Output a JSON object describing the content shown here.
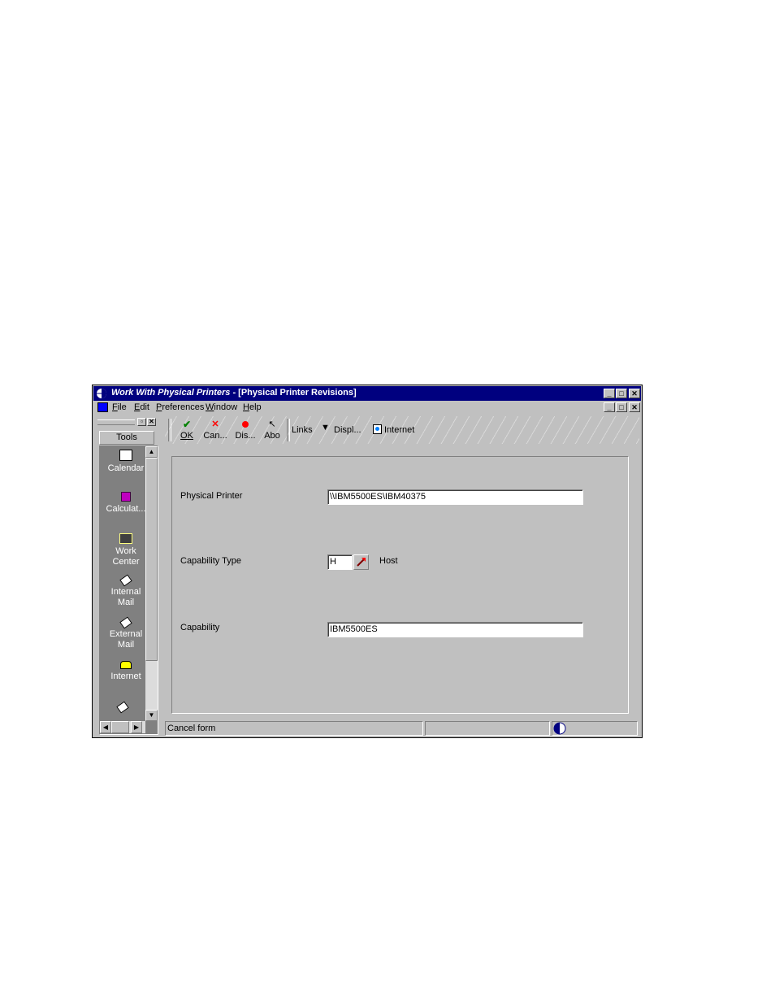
{
  "window": {
    "title_italic": "Work With Physical Printers",
    "title_rest": " - [Physical Printer Revisions]",
    "buttons": {
      "minimize": "_",
      "maximize": "□",
      "close": "✕"
    }
  },
  "menu": {
    "items": [
      {
        "underline": "F",
        "rest": "ile"
      },
      {
        "underline": "E",
        "rest": "dit"
      },
      {
        "underline": "P",
        "rest": "references"
      },
      {
        "underline": "W",
        "rest": "indow"
      },
      {
        "underline": "H",
        "rest": "elp"
      }
    ]
  },
  "tools": {
    "header": "Tools",
    "items": [
      {
        "label": "Calendar",
        "icon": "calendar-icon"
      },
      {
        "label": "Calculat...",
        "icon": "calculator-icon"
      },
      {
        "label": "Work\nCenter",
        "icon": "work-center-icon"
      },
      {
        "label": "Internal\nMail",
        "icon": "internal-mail-icon"
      },
      {
        "label": "External\nMail",
        "icon": "external-mail-icon"
      },
      {
        "label": "Internet",
        "icon": "internet-icon"
      }
    ]
  },
  "toolbar": {
    "ok": "OK",
    "cancel": "Can...",
    "display": "Dis...",
    "about": "Abo",
    "links": "Links",
    "display_menu": "Displ...",
    "internet": "Internet"
  },
  "form": {
    "physical_printer_label": "Physical Printer",
    "physical_printer_value": "\\\\IBM5500ES\\IBM40375",
    "capability_type_label": "Capability Type",
    "capability_type_value": "H",
    "capability_type_desc": "Host",
    "capability_label": "Capability",
    "capability_value": "IBM5500ES"
  },
  "status": {
    "message": "Cancel form"
  },
  "colors": {
    "title_bar": "#00007f",
    "chrome": "#c0c0c0"
  }
}
